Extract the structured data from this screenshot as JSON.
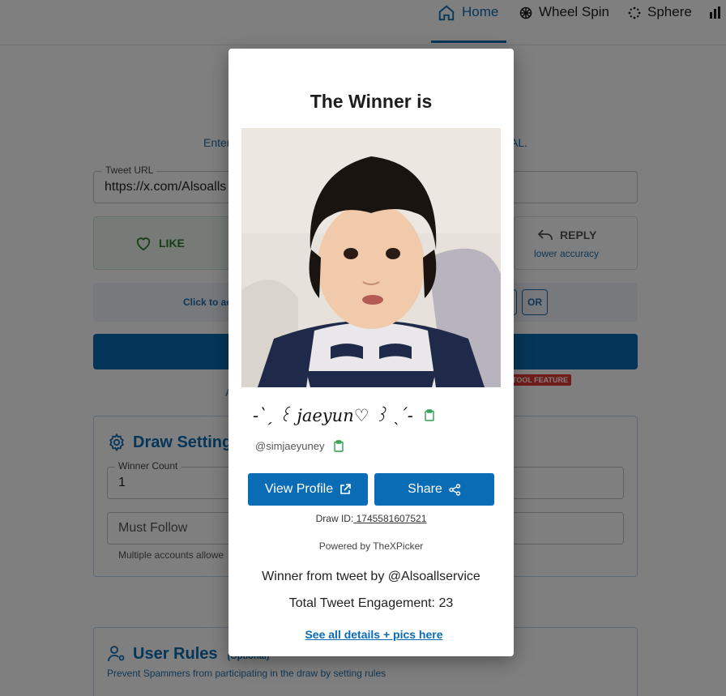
{
  "nav": {
    "home": "Home",
    "wheel": "Wheel Spin",
    "sphere": "Sphere"
  },
  "background": {
    "enter_left": "Enter",
    "enter_right": "AL.",
    "url_label": "Tweet URL",
    "url_value": "https://x.com/Alsoalls",
    "like_label": "LIKE",
    "reply_label": "REPLY",
    "reply_sub": "lower accuracy",
    "hint_text": "Click to ac",
    "or_label": "OR",
    "pro_badge": "TOOL FEATURE",
    "small_link": "A",
    "settings_title": "Draw Setting",
    "winner_count_label": "Winner Count",
    "winner_count_value": "1",
    "must_follow_placeholder": "Must Follow",
    "multi_help": "Multiple accounts allowe",
    "rules_title": "User Rules",
    "rules_optional": "(Optional)",
    "rules_sub": "Prevent Spammers from participating in the draw by setting rules"
  },
  "modal": {
    "title": "The Winner is",
    "winner_name": "-ˋˏ ꒰ jaeyun♡ ꒱ ˎˊ-",
    "handle": "@simjaeyuney",
    "view_profile": "View Profile",
    "share": "Share",
    "draw_id_label": "Draw ID:",
    "draw_id_value": " 1745581607521",
    "powered_by": "Powered by TheXPicker",
    "from_tweet": "Winner from tweet by @Alsoallservice",
    "engagement": "Total Tweet Engagement: 23",
    "details_link": "See all details + pics here"
  },
  "colors": {
    "primary": "#0a6cb5",
    "like_green": "#2e7d32",
    "badge_red": "#e53935",
    "copy_green": "#2e9e4f"
  }
}
